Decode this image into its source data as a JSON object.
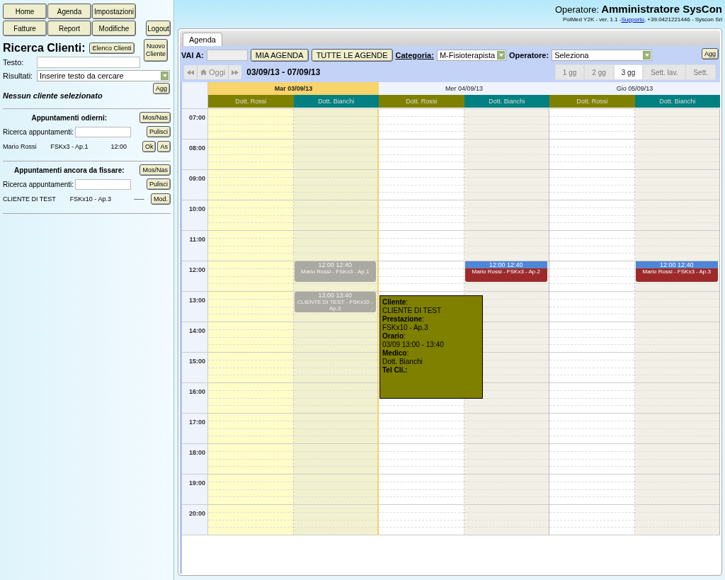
{
  "nav_buttons": [
    {
      "label": "Home"
    },
    {
      "label": "Agenda"
    },
    {
      "label": "Impostazioni"
    },
    {
      "label": "Fatture"
    },
    {
      "label": "Report"
    },
    {
      "label": "Modifiche"
    }
  ],
  "logout_button": "Logout",
  "client_search": {
    "title": "Ricerca Clienti:",
    "list_button": "Elenco Clienti",
    "new_client_button": "Nuovo Cliente",
    "text_label": "Testo:",
    "results_label": "Risultati:",
    "results_value": "Inserire testo da cercare",
    "refresh_button": "Agg",
    "status": "Nessun cliente selezionato"
  },
  "sections": [
    {
      "title": "Appuntamenti odierni:",
      "toggle_button": "Mos/Nas",
      "search_label": "Ricerca appuntamenti:",
      "clear_button": "Pulisci",
      "rows": [
        {
          "client": "Mario Rossi",
          "service": "FSKx3 - Ap.1",
          "time": "12:00",
          "actions": [
            "Ok",
            "As"
          ]
        }
      ]
    },
    {
      "title": "Appuntamenti ancora da fissare:",
      "toggle_button": "Mos/Nas",
      "search_label": "Ricerca appuntamenti:",
      "clear_button": "Pulisci",
      "rows": [
        {
          "client": "CLIENTE DI TEST",
          "service": "FSKx10 - Ap.3",
          "time": "-----",
          "actions": [
            "Mod."
          ]
        }
      ]
    }
  ],
  "header": {
    "operator_label": "Operatore:",
    "operator_name": "Amministratore SysCon",
    "info_prefix": "PolMed Y2K - ver. 1.1 -",
    "support_link": "Supporto",
    "info_suffix": ", +39.0421221446 - Syscon Srl"
  },
  "tabs": [
    {
      "label": "Agenda",
      "selected": true
    }
  ],
  "toolbar": {
    "goto_label": "VAI A:",
    "buttons": [
      "MIA AGENDA",
      "TUTTE LE AGENDE"
    ],
    "category_label": "Categoria:",
    "category_value": "M-Fisioterapista",
    "operator_label": "Operatore:",
    "operator_value": "Seleziona",
    "refresh_button": "Agg"
  },
  "date_nav": {
    "today_button": "Oggi",
    "range": "03/09/13 - 07/09/13",
    "views": [
      {
        "label": "1 gg",
        "selected": false
      },
      {
        "label": "2 gg",
        "selected": false
      },
      {
        "label": "3 gg",
        "selected": true
      },
      {
        "label": "Sett. lav.",
        "selected": false
      },
      {
        "label": "Sett.",
        "selected": false
      }
    ]
  },
  "hours": [
    "07:00",
    "08:00",
    "09:00",
    "10:00",
    "11:00",
    "12:00",
    "13:00",
    "14:00",
    "15:00",
    "16:00",
    "17:00",
    "18:00",
    "19:00",
    "20:00"
  ],
  "days": [
    {
      "label": "Mar 03/09/13",
      "selected": true,
      "doctors": [
        {
          "name": "Dott. Rossi",
          "color": "#808000"
        },
        {
          "name": "Dott. Bianchi",
          "color": "#008080",
          "events": [
            {
              "time": "12:00 12:40",
              "text": "Mario Rossi - FSKx3 - Ap.1",
              "kind": "past"
            },
            {
              "time": "13:00 13:40",
              "text": "CLIENTE DI TEST - FSKx10 - Ap.3",
              "kind": "past"
            }
          ]
        }
      ]
    },
    {
      "label": "Mer 04/09/13",
      "selected": false,
      "doctors": [
        {
          "name": "Dott. Rossi",
          "color": "#808000"
        },
        {
          "name": "Dott. Bianchi",
          "color": "#008080",
          "events": [
            {
              "time": "12:00 12:40",
              "text": "Mario Rossi - FSKx3 - Ap.2",
              "kind": "upcoming"
            }
          ]
        }
      ]
    },
    {
      "label": "Gio 05/09/13",
      "selected": false,
      "doctors": [
        {
          "name": "Dott. Rossi",
          "color": "#808000"
        },
        {
          "name": "Dott. Bianchi",
          "color": "#008080",
          "events": [
            {
              "time": "12:00 12:40",
              "text": "Mario Rossi - FSKx3 - Ap.3",
              "kind": "upcoming"
            }
          ]
        }
      ]
    }
  ],
  "tooltip": {
    "lines": [
      {
        "label": "**Cliente**:",
        "value": "CLIENTE DI TEST"
      },
      {
        "label": "**Prestazione**:",
        "value": "FSKx10 - Ap.3"
      },
      {
        "label": "**Orario**:",
        "value": "03/09 13:00 - 13:40"
      },
      {
        "label": "**Medico**:",
        "value": "Dott. Bianchi"
      },
      {
        "label": "**Tel Cli.:**"
      }
    ]
  }
}
